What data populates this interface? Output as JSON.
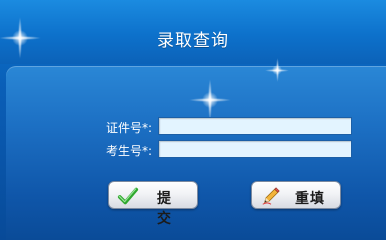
{
  "page": {
    "title": "录取查询"
  },
  "form": {
    "id_label": "证件号*:",
    "id_value": "",
    "exam_label": "考生号*:",
    "exam_value": "",
    "submit_label": "提 交",
    "reset_label": "重填"
  },
  "colors": {
    "header_blue": "#0d71cb",
    "panel_blue": "#1c6fc3",
    "field_bg": "#e3f4ff",
    "check_green": "#2ea82e"
  },
  "icons": {
    "submit": "check-icon",
    "reset": "pencil-icon"
  }
}
